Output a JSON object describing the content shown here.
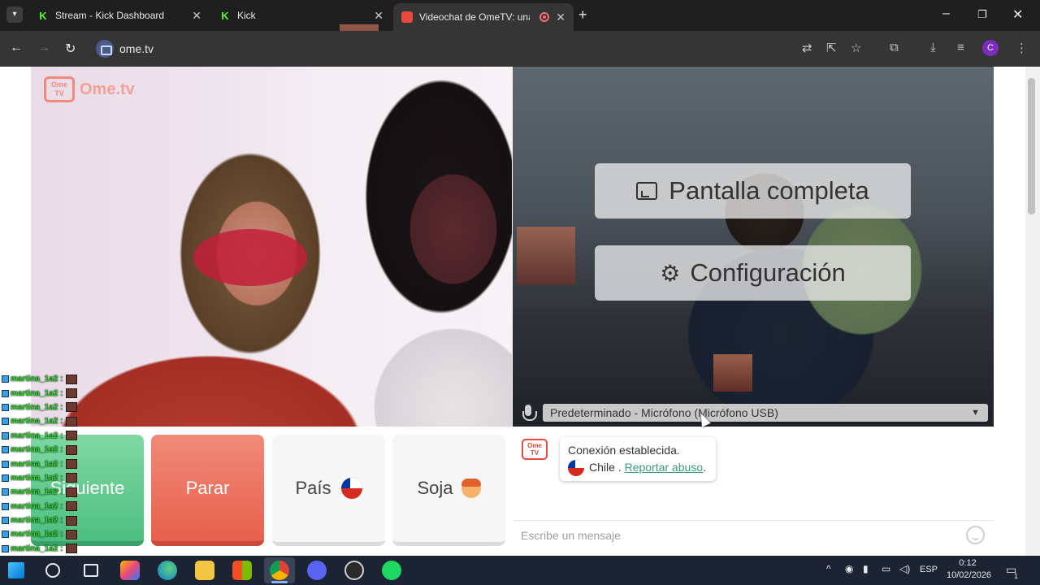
{
  "browser": {
    "tabs": [
      {
        "title": "Stream - Kick Dashboard",
        "icon": "kick-icon"
      },
      {
        "title": "Kick",
        "icon": "kick-icon"
      },
      {
        "title": "Videochat de OmeTV: una a",
        "icon": "ometv-icon",
        "active": true,
        "recording": true
      }
    ],
    "new_tab_label": "+",
    "window_controls": {
      "minimize": "–",
      "restore": "❐",
      "close": "✕"
    },
    "url": "ome.tv",
    "profile_initial": "C"
  },
  "ometv": {
    "logo_text": "Ome.tv",
    "logo_badge": "Ome TV",
    "overlay_buttons": {
      "fullscreen": "Pantalla completa",
      "settings": "Configuración"
    },
    "mic_select": "Predeterminado - Micrófono (Micrófono USB)",
    "controls": {
      "next": "Siguiente",
      "stop": "Parar",
      "country": "País",
      "gender": "Soja"
    },
    "chat": {
      "message_line1": "Conexión establecida.",
      "country": "Chile",
      "separator": ".",
      "report_link": "Reportar abuso",
      "report_suffix": ".",
      "input_placeholder": "Escribe un mensaje"
    }
  },
  "stream_overlay": {
    "chat_lines": [
      "martina_1a2 :",
      "martina_1a2 :",
      "martina_1a2 :",
      "martina_1a2 :",
      "martina_1a2 :",
      "martina_1a2 :",
      "martina_1a2 :",
      "martina_1a2 :",
      "martina_1a2 :",
      "martina_1a2 :",
      "martina_1a2 :",
      "martina_1a2 :",
      "martina_1a2 :",
      "martina_1a2 :",
      "martina_1a2 :"
    ]
  },
  "taskbar": {
    "language": "ESP",
    "time": "0:12",
    "date": "10/02/2026",
    "notifications": "1"
  },
  "colors": {
    "next_green": "#4dbf80",
    "stop_red": "#e7604c",
    "brand_coral": "#e64a3c",
    "link_green": "#3a9a7a"
  }
}
